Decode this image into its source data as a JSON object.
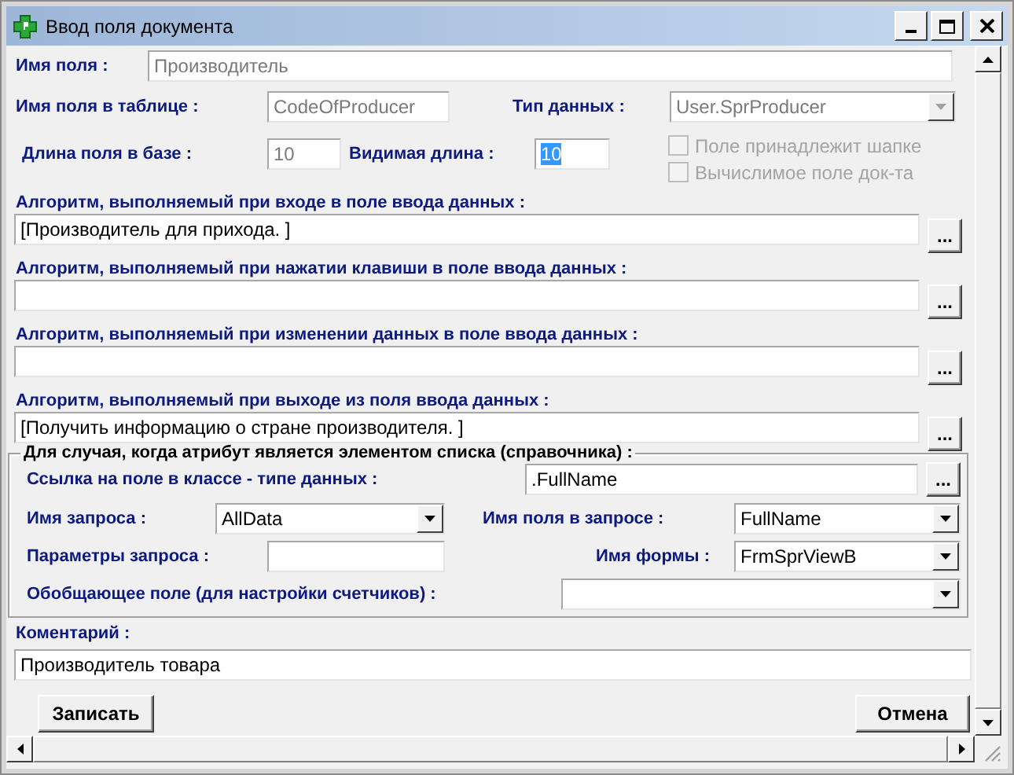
{
  "window": {
    "title": "Ввод поля документа"
  },
  "field_name": {
    "label": "Имя поля :",
    "value": "Производитель",
    "disabled": true
  },
  "table_field": {
    "label": "Имя поля в таблице :",
    "value": "CodeOfProducer",
    "disabled": true
  },
  "data_type": {
    "label": "Тип данных :",
    "value": "User.SprProducer",
    "disabled": true
  },
  "base_length": {
    "label": "Длина поля в базе :",
    "value": "10",
    "disabled": true
  },
  "visible_length": {
    "label": "Видимая длина :",
    "value": "10",
    "text_selected": true
  },
  "checkboxes": [
    {
      "label": "Поле принадлежит шапке",
      "checked": false,
      "disabled": true
    },
    {
      "label": "Вычислимое поле док-та",
      "checked": false,
      "disabled": true
    }
  ],
  "algorithms": [
    {
      "label": "Алгоритм, выполняемый при входе в поле ввода данных :",
      "value": "[Производитель для прихода. ]",
      "button": "..."
    },
    {
      "label": "Алгоритм, выполняемый при нажатии клавиши в поле ввода данных :",
      "button": "..."
    },
    {
      "label": "Алгоритм, выполняемый при изменении данных в поле ввода данных :",
      "button": "..."
    },
    {
      "label": "Алгоритм, выполняемый при выходе из поля ввода данных :",
      "value": "[Получить информацию о стране производителя. ]",
      "button": "..."
    }
  ],
  "list_group": {
    "legend": "Для случая, когда атрибут является элементом списка (справочника) :",
    "reference": {
      "label": "Ссылка на поле в классе - типе данных :",
      "value": ".FullName",
      "button": "..."
    },
    "query_name": {
      "label": "Имя запроса :",
      "value": "AllData"
    },
    "query_field": {
      "label": "Имя поля в запросе :",
      "value": "FullName"
    },
    "query_params": {
      "label": "Параметры запроса :"
    },
    "form_name": {
      "label": "Имя формы :",
      "value": "FrmSprViewB"
    },
    "summary_field": {
      "label": "Обобщающее поле (для настройки счетчиков) :"
    }
  },
  "comment": {
    "label": "Коментарий :",
    "value": "Производитель товара"
  },
  "buttons": [
    {
      "label": "Записать"
    },
    {
      "label": "Отмена"
    }
  ]
}
